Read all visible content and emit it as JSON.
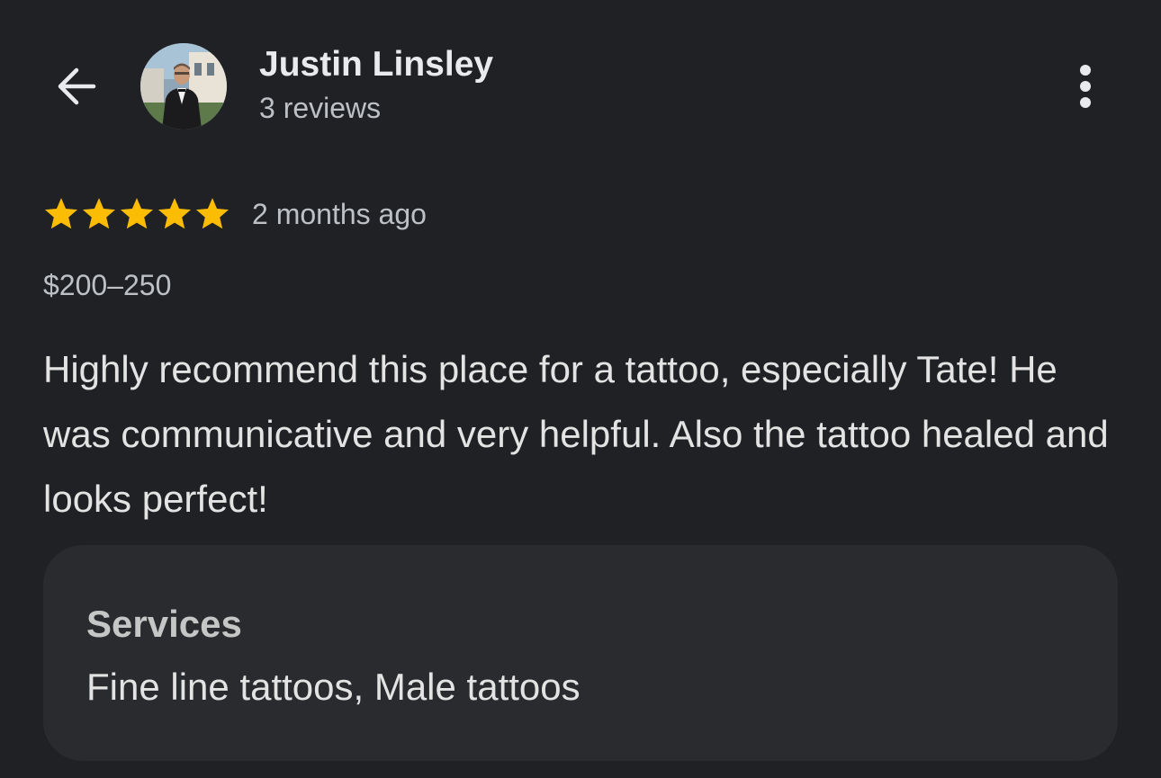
{
  "header": {
    "back_icon": "arrow-back-icon",
    "reviewer_name": "Justin Linsley",
    "review_count": "3 reviews",
    "more_icon": "more-vertical-icon"
  },
  "review": {
    "rating": 5,
    "rating_max": 5,
    "star_color": "#fbbc04",
    "time_ago": "2 months ago",
    "price": "$200–250",
    "text": "Highly recommend this place for a tattoo, especially Tate! He was communicative and very helpful. Also the tattoo healed and looks perfect!"
  },
  "services": {
    "title": "Services",
    "value": "Fine line tattoos, Male tattoos"
  },
  "colors": {
    "background": "#202124",
    "card_background": "#2a2b2e",
    "primary_text": "#e3e3e3",
    "secondary_text": "#bdc1c6"
  }
}
